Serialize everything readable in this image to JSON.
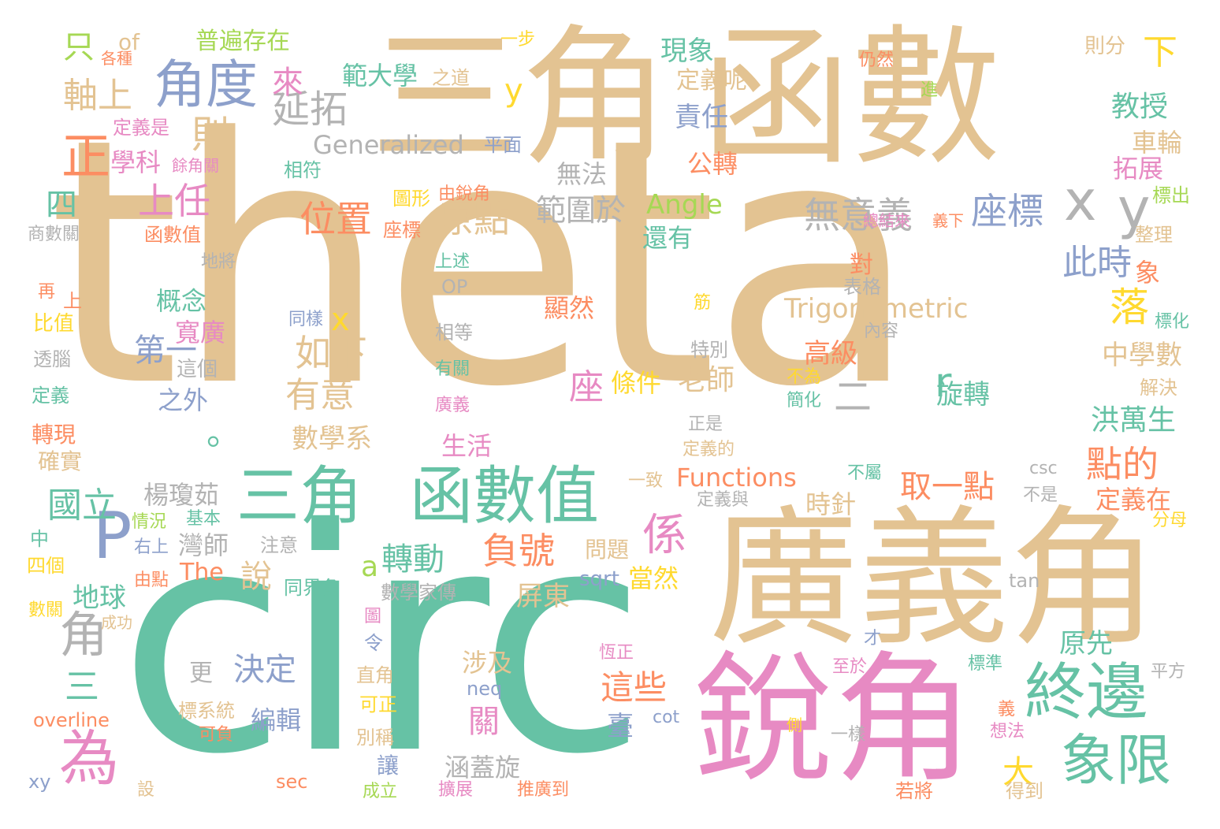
{
  "palette": {
    "tan": "#e3c392",
    "green": "#66c2a5",
    "pink": "#e78ac3",
    "orange": "#fc8d62",
    "blue": "#8da0cb",
    "gray": "#b3b3b3",
    "lime": "#a6d854",
    "yellow": "#ffd92f"
  },
  "words": [
    {
      "id": "w1",
      "text": "theta",
      "color": "tan"
    },
    {
      "id": "w2",
      "text": "circ",
      "color": "green"
    },
    {
      "id": "w3",
      "text": "三角",
      "color": "tan"
    },
    {
      "id": "w4",
      "text": "函數",
      "color": "tan"
    },
    {
      "id": "w5",
      "text": "廣義角",
      "color": "tan"
    },
    {
      "id": "w6",
      "text": "銳角",
      "color": "pink"
    },
    {
      "id": "w7",
      "text": "三角",
      "color": "green"
    },
    {
      "id": "w8",
      "text": "函數值",
      "color": "green"
    },
    {
      "id": "w9",
      "text": "角度",
      "color": "blue"
    },
    {
      "id": "w10",
      "text": "x",
      "color": "gray"
    },
    {
      "id": "w11",
      "text": "y",
      "color": "gray"
    },
    {
      "id": "w12",
      "text": "P",
      "color": "blue"
    },
    {
      "id": "w13",
      "text": "終邊",
      "color": "green"
    },
    {
      "id": "w14",
      "text": "象限",
      "color": "green"
    },
    {
      "id": "w15",
      "text": "為",
      "color": "pink"
    },
    {
      "id": "w16",
      "text": "角",
      "color": "gray"
    },
    {
      "id": "w17",
      "text": "正",
      "color": "orange"
    },
    {
      "id": "w18",
      "text": "延拓",
      "color": "gray"
    },
    {
      "id": "w19",
      "text": "座標",
      "color": "blue"
    },
    {
      "id": "w20",
      "text": "無意義",
      "color": "gray"
    },
    {
      "id": "w21",
      "text": "位置",
      "color": "orange"
    },
    {
      "id": "w22",
      "text": "原點",
      "color": "tan"
    },
    {
      "id": "w23",
      "text": "範圍於",
      "color": "gray"
    },
    {
      "id": "w24",
      "text": "上任",
      "color": "pink"
    },
    {
      "id": "w25",
      "text": "則",
      "color": "tan"
    },
    {
      "id": "w26",
      "text": "軸上",
      "color": "tan"
    },
    {
      "id": "w27",
      "text": "只",
      "color": "lime"
    },
    {
      "id": "w28",
      "text": "of",
      "color": "tan"
    },
    {
      "id": "w29",
      "text": "普遍存在",
      "color": "lime"
    },
    {
      "id": "w30",
      "text": "範大學",
      "color": "green"
    },
    {
      "id": "w31",
      "text": "之道",
      "color": "tan"
    },
    {
      "id": "w32",
      "text": "一步",
      "color": "yellow"
    },
    {
      "id": "w33",
      "text": "現象",
      "color": "green"
    },
    {
      "id": "w34",
      "text": "定義呢",
      "color": "tan"
    },
    {
      "id": "w35",
      "text": "責任",
      "color": "blue"
    },
    {
      "id": "w36",
      "text": "仍然",
      "color": "orange"
    },
    {
      "id": "w37",
      "text": "則分",
      "color": "tan"
    },
    {
      "id": "w38",
      "text": "下",
      "color": "yellow"
    },
    {
      "id": "w39",
      "text": "進",
      "color": "lime"
    },
    {
      "id": "w40",
      "text": "教授",
      "color": "green"
    },
    {
      "id": "w41",
      "text": "車輪",
      "color": "tan"
    },
    {
      "id": "w42",
      "text": "拓展",
      "color": "pink"
    },
    {
      "id": "w43",
      "text": "標出",
      "color": "lime"
    },
    {
      "id": "w44",
      "text": "Generalized",
      "color": "gray"
    },
    {
      "id": "w45",
      "text": "平面",
      "color": "blue"
    },
    {
      "id": "w46",
      "text": "學科",
      "color": "pink"
    },
    {
      "id": "w47",
      "text": "餘角關",
      "color": "pink"
    },
    {
      "id": "w48",
      "text": "相符",
      "color": "green"
    },
    {
      "id": "w49",
      "text": "定義是",
      "color": "pink"
    },
    {
      "id": "w50",
      "text": "來",
      "color": "pink"
    },
    {
      "id": "w51",
      "text": "y",
      "color": "yellow"
    },
    {
      "id": "w52",
      "text": "公轉",
      "color": "orange"
    },
    {
      "id": "w53",
      "text": "無法",
      "color": "gray"
    },
    {
      "id": "w54",
      "text": "Angle",
      "color": "lime"
    },
    {
      "id": "w55",
      "text": "還有",
      "color": "green"
    },
    {
      "id": "w56",
      "text": "四",
      "color": "green"
    },
    {
      "id": "w57",
      "text": "商數關",
      "color": "gray"
    },
    {
      "id": "w58",
      "text": "函數值",
      "color": "orange"
    },
    {
      "id": "w59",
      "text": "圖形",
      "color": "yellow"
    },
    {
      "id": "w60",
      "text": "由銳角",
      "color": "orange"
    },
    {
      "id": "w61",
      "text": "座標",
      "color": "orange"
    },
    {
      "id": "w62",
      "text": "總結來",
      "color": "pink"
    },
    {
      "id": "w63",
      "text": "義下",
      "color": "orange"
    },
    {
      "id": "w64",
      "text": "整理",
      "color": "tan"
    },
    {
      "id": "w65",
      "text": "地將",
      "color": "gray"
    },
    {
      "id": "w66",
      "text": "上述",
      "color": "green"
    },
    {
      "id": "w67",
      "text": "對",
      "color": "orange"
    },
    {
      "id": "w68",
      "text": "此時",
      "color": "blue"
    },
    {
      "id": "w69",
      "text": "象",
      "color": "orange"
    },
    {
      "id": "w70",
      "text": "概念",
      "color": "green"
    },
    {
      "id": "w71",
      "text": "OP",
      "color": "gray"
    },
    {
      "id": "w72",
      "text": "表格",
      "color": "gray"
    },
    {
      "id": "w73",
      "text": "再",
      "color": "orange"
    },
    {
      "id": "w74",
      "text": "上",
      "color": "orange"
    },
    {
      "id": "w75",
      "text": "筋",
      "color": "yellow"
    },
    {
      "id": "w76",
      "text": "落",
      "color": "yellow"
    },
    {
      "id": "w77",
      "text": "比值",
      "color": "yellow"
    },
    {
      "id": "w78",
      "text": "同樣",
      "color": "blue"
    },
    {
      "id": "w79",
      "text": "顯然",
      "color": "orange"
    },
    {
      "id": "w80",
      "text": "Trigonometric",
      "color": "tan"
    },
    {
      "id": "w81",
      "text": "內容",
      "color": "gray"
    },
    {
      "id": "w82",
      "text": "標化",
      "color": "green"
    },
    {
      "id": "w83",
      "text": "寬廣",
      "color": "pink"
    },
    {
      "id": "w84",
      "text": "x",
      "color": "yellow"
    },
    {
      "id": "w85",
      "text": "第一",
      "color": "blue"
    },
    {
      "id": "w86",
      "text": "如下",
      "color": "tan"
    },
    {
      "id": "w87",
      "text": "相等",
      "color": "gray"
    },
    {
      "id": "w88",
      "text": "特別",
      "color": "gray"
    },
    {
      "id": "w89",
      "text": "高級",
      "color": "orange"
    },
    {
      "id": "w90",
      "text": "中學數",
      "color": "tan"
    },
    {
      "id": "w91",
      "text": "透腦",
      "color": "gray"
    },
    {
      "id": "w92",
      "text": "這個",
      "color": "gray"
    },
    {
      "id": "w93",
      "text": "有關",
      "color": "green"
    },
    {
      "id": "w94",
      "text": "不為",
      "color": "yellow"
    },
    {
      "id": "w95",
      "text": "簡化",
      "color": "green"
    },
    {
      "id": "w96",
      "text": "旋轉",
      "color": "green"
    },
    {
      "id": "w97",
      "text": "解決",
      "color": "tan"
    },
    {
      "id": "w98",
      "text": "定義",
      "color": "green"
    },
    {
      "id": "w99",
      "text": "之外",
      "color": "blue"
    },
    {
      "id": "w100",
      "text": "有意",
      "color": "tan"
    },
    {
      "id": "w101",
      "text": "座",
      "color": "pink"
    },
    {
      "id": "w102",
      "text": "條件",
      "color": "yellow"
    },
    {
      "id": "w103",
      "text": "老師",
      "color": "tan"
    },
    {
      "id": "w104",
      "text": "二",
      "color": "gray"
    },
    {
      "id": "w105",
      "text": "r",
      "color": "green"
    },
    {
      "id": "w106",
      "text": "廣義",
      "color": "pink"
    },
    {
      "id": "w107",
      "text": "洪萬生",
      "color": "green"
    },
    {
      "id": "w108",
      "text": "正是",
      "color": "gray"
    },
    {
      "id": "w109",
      "text": "轉現",
      "color": "orange"
    },
    {
      "id": "w110",
      "text": "確實",
      "color": "tan"
    },
    {
      "id": "w111",
      "text": "。",
      "color": "green"
    },
    {
      "id": "w112",
      "text": "數學系",
      "color": "tan"
    },
    {
      "id": "w113",
      "text": "生活",
      "color": "pink"
    },
    {
      "id": "w114",
      "text": "定義的",
      "color": "tan"
    },
    {
      "id": "w115",
      "text": "點的",
      "color": "orange"
    },
    {
      "id": "w116",
      "text": "Functions",
      "color": "orange"
    },
    {
      "id": "w117",
      "text": "一致",
      "color": "tan"
    },
    {
      "id": "w118",
      "text": "不屬",
      "color": "green"
    },
    {
      "id": "w119",
      "text": "csc",
      "color": "gray"
    },
    {
      "id": "w120",
      "text": "不是",
      "color": "gray"
    },
    {
      "id": "w121",
      "text": "國立",
      "color": "green"
    },
    {
      "id": "w122",
      "text": "楊瓊茹",
      "color": "gray"
    },
    {
      "id": "w123",
      "text": "取一點",
      "color": "orange"
    },
    {
      "id": "w124",
      "text": "定義與",
      "color": "gray"
    },
    {
      "id": "w125",
      "text": "時針",
      "color": "tan"
    },
    {
      "id": "w126",
      "text": "定義在",
      "color": "orange"
    },
    {
      "id": "w127",
      "text": "分母",
      "color": "yellow"
    },
    {
      "id": "w128",
      "text": "情況",
      "color": "lime"
    },
    {
      "id": "w129",
      "text": "基本",
      "color": "green"
    },
    {
      "id": "w130",
      "text": "中",
      "color": "green"
    },
    {
      "id": "w131",
      "text": "係",
      "color": "pink"
    },
    {
      "id": "w132",
      "text": "注意",
      "color": "gray"
    },
    {
      "id": "w133",
      "text": "右上",
      "color": "blue"
    },
    {
      "id": "w134",
      "text": "灣師",
      "color": "gray"
    },
    {
      "id": "w135",
      "text": "負號",
      "color": "orange"
    },
    {
      "id": "w136",
      "text": "轉動",
      "color": "green"
    },
    {
      "id": "w137",
      "text": "問題",
      "color": "tan"
    },
    {
      "id": "w138",
      "text": "四個",
      "color": "yellow"
    },
    {
      "id": "w139",
      "text": "由點",
      "color": "orange"
    },
    {
      "id": "w140",
      "text": "The",
      "color": "orange"
    },
    {
      "id": "w141",
      "text": "說",
      "color": "tan"
    },
    {
      "id": "w142",
      "text": "同界角",
      "color": "green"
    },
    {
      "id": "w143",
      "text": "a",
      "color": "lime"
    },
    {
      "id": "w144",
      "text": "sqrt",
      "color": "blue"
    },
    {
      "id": "w145",
      "text": "當然",
      "color": "yellow"
    },
    {
      "id": "w146",
      "text": "tan",
      "color": "gray"
    },
    {
      "id": "w147",
      "text": "地球",
      "color": "green"
    },
    {
      "id": "w148",
      "text": "數學家傳",
      "color": "gray"
    },
    {
      "id": "w149",
      "text": "屏東",
      "color": "tan"
    },
    {
      "id": "w150",
      "text": "數關",
      "color": "yellow"
    },
    {
      "id": "w151",
      "text": "成功",
      "color": "tan"
    },
    {
      "id": "w152",
      "text": "圖",
      "color": "pink"
    },
    {
      "id": "w153",
      "text": "令",
      "color": "blue"
    },
    {
      "id": "w154",
      "text": "才",
      "color": "blue"
    },
    {
      "id": "w155",
      "text": "恆正",
      "color": "pink"
    },
    {
      "id": "w156",
      "text": "原先",
      "color": "green"
    },
    {
      "id": "w157",
      "text": "更",
      "color": "gray"
    },
    {
      "id": "w158",
      "text": "決定",
      "color": "blue"
    },
    {
      "id": "w159",
      "text": "涉及",
      "color": "tan"
    },
    {
      "id": "w160",
      "text": "標準",
      "color": "green"
    },
    {
      "id": "w161",
      "text": "平方",
      "color": "gray"
    },
    {
      "id": "w162",
      "text": "三",
      "color": "green"
    },
    {
      "id": "w163",
      "text": "直角",
      "color": "tan"
    },
    {
      "id": "w164",
      "text": "至於",
      "color": "pink"
    },
    {
      "id": "w165",
      "text": "這些",
      "color": "orange"
    },
    {
      "id": "w166",
      "text": "neq",
      "color": "blue"
    },
    {
      "id": "w167",
      "text": "可正",
      "color": "yellow"
    },
    {
      "id": "w168",
      "text": "overline",
      "color": "orange"
    },
    {
      "id": "w169",
      "text": "標系統",
      "color": "tan"
    },
    {
      "id": "w170",
      "text": "編輯",
      "color": "blue"
    },
    {
      "id": "w171",
      "text": "cot",
      "color": "blue"
    },
    {
      "id": "w172",
      "text": "側",
      "color": "yellow"
    },
    {
      "id": "w173",
      "text": "義",
      "color": "orange"
    },
    {
      "id": "w174",
      "text": "想法",
      "color": "pink"
    },
    {
      "id": "w175",
      "text": "一樣",
      "color": "gray"
    },
    {
      "id": "w176",
      "text": "關",
      "color": "pink"
    },
    {
      "id": "w177",
      "text": "臺",
      "color": "blue"
    },
    {
      "id": "w178",
      "text": "可負",
      "color": "orange"
    },
    {
      "id": "w179",
      "text": "別稱",
      "color": "tan"
    },
    {
      "id": "w180",
      "text": "讓",
      "color": "blue"
    },
    {
      "id": "w181",
      "text": "涵蓋旋",
      "color": "gray"
    },
    {
      "id": "w182",
      "text": "大",
      "color": "yellow"
    },
    {
      "id": "w183",
      "text": "xy",
      "color": "blue"
    },
    {
      "id": "w184",
      "text": "sec",
      "color": "orange"
    },
    {
      "id": "w185",
      "text": "設",
      "color": "tan"
    },
    {
      "id": "w186",
      "text": "成立",
      "color": "lime"
    },
    {
      "id": "w187",
      "text": "擴展",
      "color": "pink"
    },
    {
      "id": "w188",
      "text": "推廣到",
      "color": "orange"
    },
    {
      "id": "w189",
      "text": "若將",
      "color": "orange"
    },
    {
      "id": "w190",
      "text": "得到",
      "color": "tan"
    },
    {
      "id": "w191",
      "text": "各種",
      "color": "orange"
    }
  ]
}
